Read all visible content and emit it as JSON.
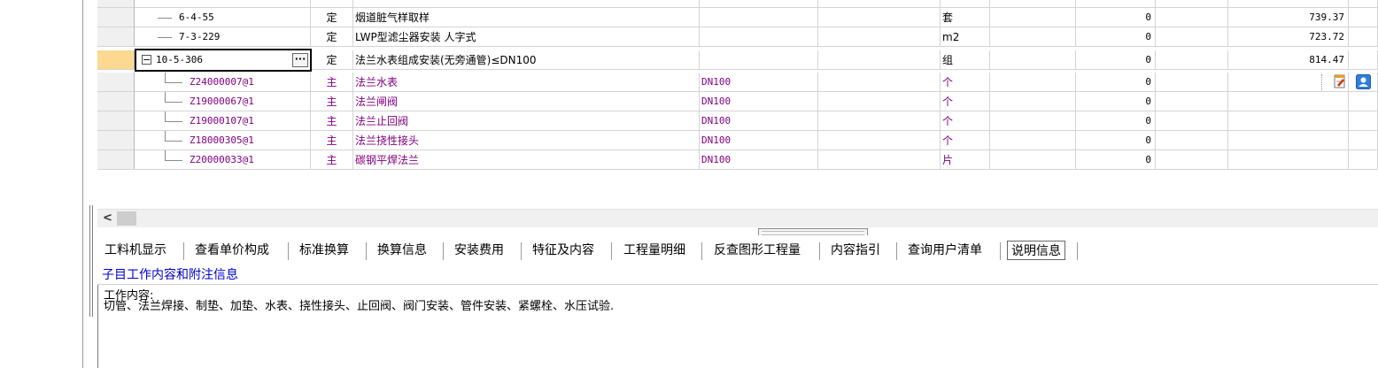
{
  "rows": [
    {
      "code": "6-4-55",
      "type": "定",
      "name": "烟道脏气样取样",
      "spec": "",
      "unit": "套",
      "qty": "0",
      "price": "739.37",
      "kind": "sub"
    },
    {
      "code": "7-3-229",
      "type": "定",
      "name": "LWP型滤尘器安装 人字式",
      "spec": "",
      "unit": "m2",
      "qty": "0",
      "price": "723.72",
      "kind": "sub"
    },
    {
      "code": "10-5-306",
      "type": "定",
      "name": "法兰水表组成安装(无旁通管)≤DN100",
      "spec": "",
      "unit": "组",
      "qty": "0",
      "price": "814.47",
      "kind": "selected"
    },
    {
      "code": "Z24000007@1",
      "type": "主",
      "name": "法兰水表",
      "spec": "DN100",
      "unit": "个",
      "qty": "0",
      "price": "",
      "kind": "main"
    },
    {
      "code": "Z19000067@1",
      "type": "主",
      "name": "法兰闸阀",
      "spec": "DN100",
      "unit": "个",
      "qty": "0",
      "price": "",
      "kind": "main"
    },
    {
      "code": "Z19000107@1",
      "type": "主",
      "name": "法兰止回阀",
      "spec": "DN100",
      "unit": "个",
      "qty": "0",
      "price": "",
      "kind": "main"
    },
    {
      "code": "Z18000305@1",
      "type": "主",
      "name": "法兰挠性接头",
      "spec": "DN100",
      "unit": "个",
      "qty": "0",
      "price": "",
      "kind": "main"
    },
    {
      "code": "Z20000033@1",
      "type": "主",
      "name": "碳钢平焊法兰",
      "spec": "DN100",
      "unit": "片",
      "qty": "0",
      "price": "",
      "kind": "main"
    }
  ],
  "expander_symbol": "−",
  "ellipsis_label": "···",
  "scroll_left_arrow": "<",
  "tabs": [
    {
      "label": "工料机显示"
    },
    {
      "label": "查看单价构成"
    },
    {
      "label": "标准换算"
    },
    {
      "label": "换算信息"
    },
    {
      "label": "安装费用"
    },
    {
      "label": "特征及内容"
    },
    {
      "label": "工程量明细"
    },
    {
      "label": "反查图形工程量"
    },
    {
      "label": "内容指引"
    },
    {
      "label": "查询用户清单"
    },
    {
      "label": "说明信息",
      "active": true
    }
  ],
  "subtitle": "子目工作内容和附注信息",
  "description": {
    "heading": "工作内容:",
    "body": "切管、法兰焊接、制垫、加垫、水表、挠性接头、止回阀、阀门安装、管件安装、紧螺栓、水压试验."
  },
  "icons": {
    "doc": "document-edit-icon",
    "user": "user-contact-icon"
  },
  "colors": {
    "main_text": "#800080",
    "selected_indicator": "#fcd890",
    "subtitle": "#0000cc"
  }
}
